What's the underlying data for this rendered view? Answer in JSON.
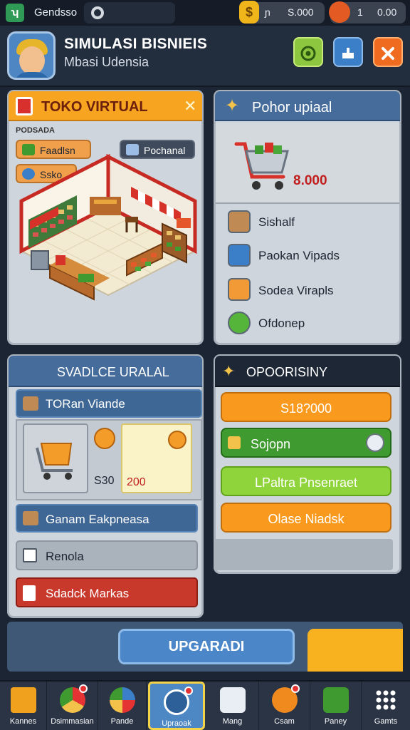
{
  "status_bar": {
    "app_name": "Gendsso",
    "resource_1": {
      "a": "ɲ",
      "b": "S.000"
    },
    "resource_2": {
      "a": "1",
      "b": "0.00"
    }
  },
  "header": {
    "title": "SIMULASI BISNIEIS",
    "subtitle": "Mbasi Udensia"
  },
  "toko": {
    "title": "TOKO VIRTUAL",
    "label": "PODSADA",
    "chips": [
      "Faadlsn",
      "Pochanal",
      "Ssko"
    ]
  },
  "pohon": {
    "title": "Pohor upiaal",
    "price": "8.000",
    "items": [
      "Sishalf",
      "Paokan Vipads",
      "Sodea Virapls",
      "Ofdonep"
    ]
  },
  "shop": {
    "title": "SVADLCE URALAL",
    "row_title": "TORan Viande",
    "card1_value": "S30",
    "card2_value": "200",
    "rows": [
      "Ganam Eakpneasa",
      "Renola",
      "Sdadck Markas"
    ]
  },
  "opor": {
    "title": "OPOORISINY",
    "buttons": [
      "S18?000",
      "Sojopn",
      "LPaltra Pnsenraet",
      "Olase Niadsk"
    ]
  },
  "footer": {
    "upgrade_label": "UPGARADI"
  },
  "nav": {
    "items": [
      "Kannes",
      "Dsimmasian",
      "Pande",
      "Upraoak",
      "Mang",
      "Csam",
      "Paney",
      "Gamts"
    ]
  },
  "colors": {
    "accent_orange": "#f7a420",
    "panel_blue": "#456c9b",
    "price_red": "#c11d1d"
  }
}
